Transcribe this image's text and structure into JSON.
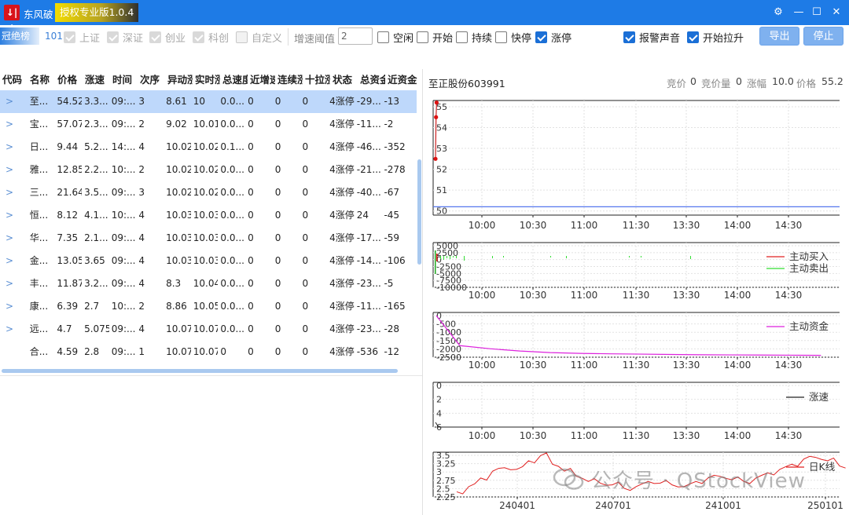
{
  "app": {
    "name": "东风破",
    "version": "授权专业版1.0.4",
    "logo_text": "↓|↑"
  },
  "window_controls": [
    "⚙",
    "—",
    "☐",
    "✕"
  ],
  "toolbar": {
    "champion_tag": "冠绝榜",
    "count": "101",
    "markets": [
      {
        "label": "上证",
        "checked": true
      },
      {
        "label": "深证",
        "checked": true
      },
      {
        "label": "创业",
        "checked": true
      },
      {
        "label": "科创",
        "checked": true
      },
      {
        "label": "自定义",
        "checked": false
      }
    ],
    "threshold_label": "增速阈值",
    "threshold_value": "2",
    "states": [
      {
        "label": "空闲",
        "checked": false
      },
      {
        "label": "开始",
        "checked": false
      },
      {
        "label": "持续",
        "checked": false
      },
      {
        "label": "快停",
        "checked": false
      },
      {
        "label": "涨停",
        "checked": true
      }
    ],
    "alert_sound": {
      "label": "报警声音",
      "checked": true
    },
    "start_lift": {
      "label": "开始拉升",
      "checked": true
    },
    "export_label": "导出",
    "stop_label": "停止"
  },
  "table": {
    "columns": [
      "代码",
      "名称",
      "价格",
      "涨速",
      "时间",
      "次序",
      "异动涨",
      "实时涨",
      "总速度",
      "近增速",
      "连续涨",
      "十拉涨",
      "状态",
      "总资金",
      "近资金"
    ],
    "rows": [
      [
        "至...",
        "54.52",
        "3.3...",
        "09:...",
        "3",
        "8.61",
        "10",
        "0.0...",
        "0",
        "0",
        "0",
        "4涨停",
        "-29...",
        "-13"
      ],
      [
        "宝...",
        "57.07",
        "2.3...",
        "09:...",
        "2",
        "9.02",
        "10.01",
        "0.0...",
        "0",
        "0",
        "0",
        "4涨停",
        "-11...",
        "-2"
      ],
      [
        "日...",
        "9.44",
        "5.2...",
        "14:...",
        "4",
        "10.02",
        "10.02",
        "0.1...",
        "0",
        "0",
        "0",
        "4涨停",
        "-46...",
        "-352"
      ],
      [
        "雅...",
        "12.85",
        "2.2...",
        "10:...",
        "2",
        "10.02",
        "10.02",
        "0.0...",
        "0",
        "0",
        "0",
        "4涨停",
        "-21...",
        "-278"
      ],
      [
        "三...",
        "21.64",
        "3.5...",
        "09:...",
        "3",
        "10.02",
        "10.02",
        "0.0...",
        "0",
        "0",
        "0",
        "4涨停",
        "-40...",
        "-67"
      ],
      [
        "恒...",
        "8.12",
        "4.1...",
        "10:...",
        "4",
        "10.03",
        "10.03",
        "0.0...",
        "0",
        "0",
        "0",
        "4涨停",
        "24",
        "-45"
      ],
      [
        "华...",
        "7.35",
        "2.1...",
        "09:...",
        "4",
        "10.03",
        "10.03",
        "0.0...",
        "0",
        "0",
        "0",
        "4涨停",
        "-17...",
        "-59"
      ],
      [
        "金...",
        "13.05",
        "3.65",
        "09:...",
        "4",
        "10.03",
        "10.03",
        "0.0...",
        "0",
        "0",
        "0",
        "4涨停",
        "-14...",
        "-106"
      ],
      [
        "丰...",
        "11.87",
        "3.2...",
        "09:...",
        "4",
        "8.3",
        "10.04",
        "0.0...",
        "0",
        "0",
        "0",
        "4涨停",
        "-23...",
        "-5"
      ],
      [
        "康...",
        "6.39",
        "2.7",
        "10:...",
        "2",
        "8.86",
        "10.05",
        "0.0...",
        "0",
        "0",
        "0",
        "4涨停",
        "-11...",
        "-165"
      ],
      [
        "远...",
        "4.7",
        "5.075",
        "09:...",
        "4",
        "10.07",
        "10.07",
        "0.0...",
        "0",
        "0",
        "0",
        "4涨停",
        "-23...",
        "-28"
      ],
      [
        "合...",
        "4.59",
        "2.8",
        "09:...",
        "1",
        "10.07",
        "10.07",
        "0",
        "0",
        "0",
        "0",
        "4涨停",
        "-536",
        "-12"
      ]
    ],
    "expander_glyph": ">"
  },
  "stock": {
    "title": "至正股份603991",
    "quote_labels": [
      "竞价",
      "竞价量",
      "涨幅",
      "价格"
    ],
    "quote_values": [
      "0",
      "0",
      "10.0",
      "55.2"
    ]
  },
  "chart_data": [
    {
      "type": "line",
      "title": "至正股份603991",
      "x": [
        "09:30",
        "09:31",
        "09:32",
        "09:33",
        "15:00"
      ],
      "series": [
        {
          "name": "",
          "values": [
            52.5,
            54.5,
            55.2,
            55.2,
            55.2
          ]
        }
      ],
      "xticks": [
        "10:00",
        "10:30",
        "11:00",
        "11:30",
        "13:30",
        "14:00",
        "14:30"
      ],
      "yticks": [
        "50",
        "51",
        "52",
        "53",
        "54",
        "55"
      ],
      "ylim": [
        49.8,
        55.3
      ],
      "baseline": 50.2,
      "grid": true
    },
    {
      "type": "bar",
      "series": [
        {
          "name": "主动买入",
          "color": "#e02020"
        },
        {
          "name": "主动卖出",
          "color": "#33dd33"
        }
      ],
      "xticks": [
        "10:00",
        "10:30",
        "11:00",
        "11:30",
        "13:30",
        "14:00",
        "14:30"
      ],
      "yticks": [
        "5000",
        "2500",
        "0",
        "-2500",
        "-5000",
        "-7500",
        "-10000"
      ],
      "legend": "right"
    },
    {
      "type": "line",
      "series": [
        {
          "name": "主动资金",
          "color": "#dd22dd",
          "values": [
            0,
            -1950,
            -2150,
            -2300,
            -2400,
            -2450,
            -2480,
            -2500,
            -2520,
            -2540,
            -2550,
            -2560,
            -2570,
            -2580
          ]
        }
      ],
      "xticks": [
        "10:00",
        "10:30",
        "11:00",
        "11:30",
        "13:30",
        "14:00",
        "14:30"
      ],
      "yticks": [
        "0",
        "-500",
        "-1000",
        "-1500",
        "-2000",
        "-2500"
      ],
      "legend": "right"
    },
    {
      "type": "line",
      "series": [
        {
          "name": "涨速",
          "color": "#222222",
          "values": [
            0.3,
            0,
            0,
            0,
            0,
            0
          ]
        }
      ],
      "xticks": [
        "10:00",
        "10:30",
        "11:00",
        "11:30",
        "13:30",
        "14:00",
        "14:30"
      ],
      "yticks": [
        "0",
        "2",
        "4",
        "6"
      ],
      "legend": "right"
    },
    {
      "type": "line",
      "series": [
        {
          "name": "日K线",
          "color": "#e02020",
          "values": [
            2.3,
            2.45,
            2.7,
            2.9,
            3.0,
            2.95,
            3.2,
            3.35,
            3.1,
            2.9,
            2.75,
            2.6,
            2.55,
            2.5,
            2.4,
            2.45,
            2.6,
            2.55,
            2.5,
            2.45,
            2.6,
            2.7,
            2.75,
            2.65,
            2.6,
            2.7,
            2.85,
            2.95,
            3.1,
            3.25,
            3.3,
            3.2,
            3.05
          ]
        }
      ],
      "xticks": [
        "240401",
        "240701",
        "241001",
        "250101"
      ],
      "yticks": [
        "3.5",
        "3.25",
        "3",
        "2.75",
        "2.5",
        "2.25"
      ],
      "legend": "right"
    }
  ],
  "watermark": "公众号 · QStockView"
}
